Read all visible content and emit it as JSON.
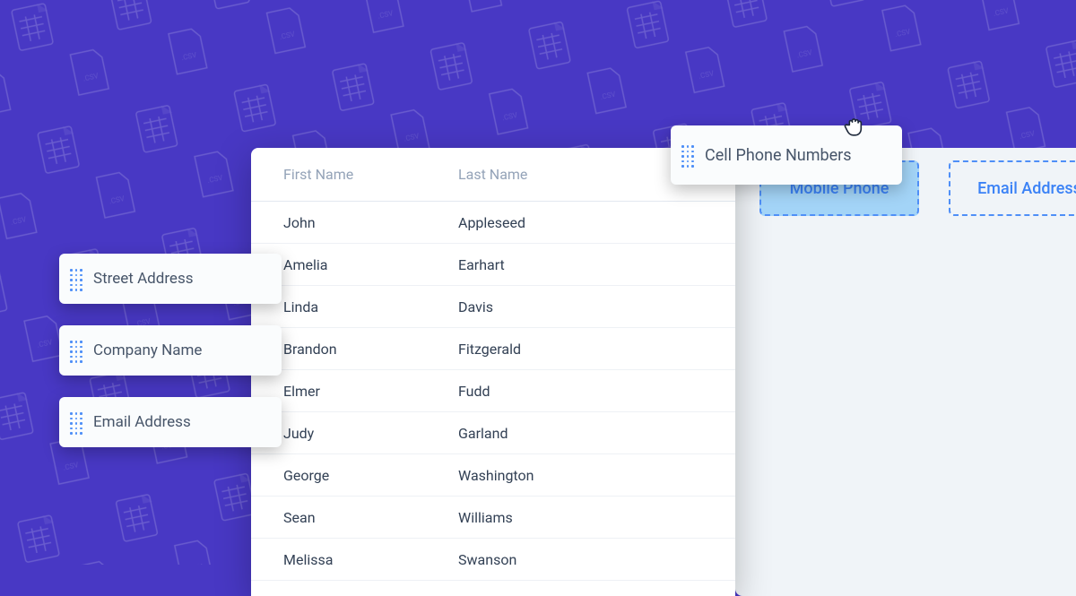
{
  "table": {
    "headers": {
      "first": "First Name",
      "last": "Last Name"
    },
    "rows": [
      {
        "first": "John",
        "last": "Appleseed"
      },
      {
        "first": "Amelia",
        "last": "Earhart"
      },
      {
        "first": "Linda",
        "last": "Davis"
      },
      {
        "first": "Brandon",
        "last": "Fitzgerald"
      },
      {
        "first": "Elmer",
        "last": "Fudd"
      },
      {
        "first": "Judy",
        "last": "Garland"
      },
      {
        "first": "George",
        "last": "Washington"
      },
      {
        "first": "Sean",
        "last": "Williams"
      },
      {
        "first": "Melissa",
        "last": "Swanson"
      }
    ]
  },
  "source_fields": {
    "street": "Street Address",
    "company": "Company Name",
    "email": "Email Address",
    "cell_phone": "Cell Phone Numbers"
  },
  "dropzones": {
    "mobile": "Mobile Phone",
    "email": "Email Address"
  }
}
